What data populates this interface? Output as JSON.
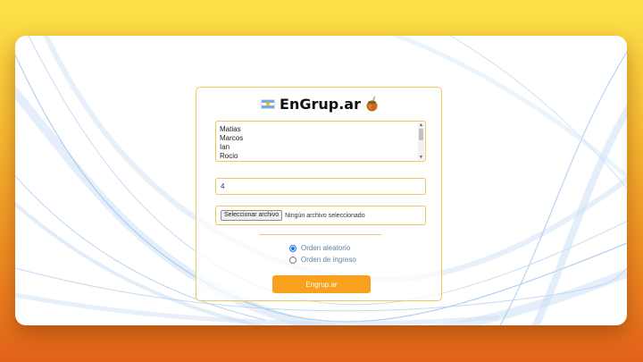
{
  "app": {
    "title": "EnGrup.ar",
    "flag_icon": "argentina-flag-icon",
    "logo_icon": "mate-gourd-icon"
  },
  "names_input": {
    "lines": [
      "Matias",
      "Marcos",
      "Ian",
      "Rocio"
    ]
  },
  "groups_input": {
    "value": "4"
  },
  "file_input": {
    "button_label": "Seleccionar archivo",
    "status_text": "Ningún archivo seleccionado"
  },
  "order_options": [
    {
      "label": "Orden aleatorio",
      "checked": true
    },
    {
      "label": "Orden de ingreso",
      "checked": false
    }
  ],
  "submit": {
    "label": "Engrup.ar"
  },
  "colors": {
    "accent": "#f9a01c",
    "border": "#f0c55a",
    "radio_label": "#5b84a8",
    "background_top": "#fbe24a",
    "background_bottom": "#e2621a"
  }
}
